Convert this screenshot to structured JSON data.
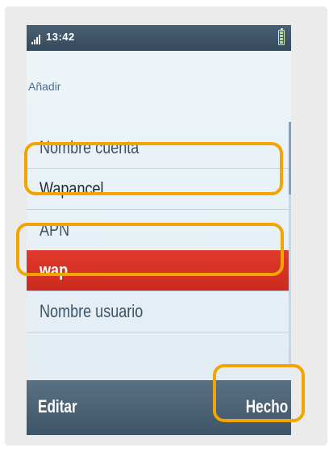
{
  "status_bar": {
    "time": "13:42",
    "signal_icon": "signal-bars-icon",
    "battery_icon": "battery-icon"
  },
  "screen": {
    "title": "Añadir"
  },
  "form": {
    "account_name_label": "Nombre cuenta",
    "account_name_value": "Wapancel",
    "apn_label": "APN",
    "apn_value": "wap",
    "username_label": "Nombre usuario"
  },
  "softkeys": {
    "left": "Editar",
    "right": "Hecho"
  },
  "colors": {
    "highlight": "#f2a400",
    "selected_row": "#d8322a",
    "status_bar": "#3e5467"
  }
}
